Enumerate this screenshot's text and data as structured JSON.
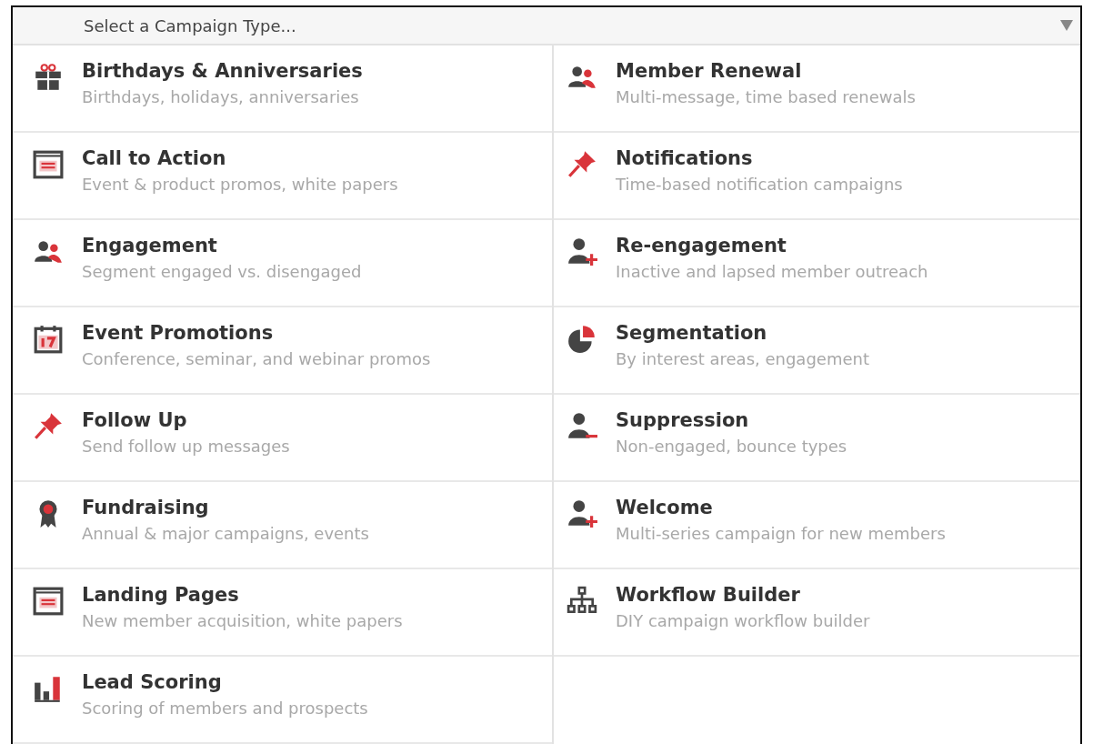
{
  "select": {
    "placeholder": "Select a Campaign Type..."
  },
  "columns": [
    {
      "items": [
        {
          "kind": "gift",
          "title": "Birthdays & Anniversaries",
          "description": "Birthdays, holidays, anniversaries"
        },
        {
          "kind": "page",
          "title": "Call to Action",
          "description": "Event & product promos, white papers"
        },
        {
          "kind": "people",
          "title": "Engagement",
          "description": "Segment engaged vs. disengaged"
        },
        {
          "kind": "calendar",
          "title": "Event Promotions",
          "description": "Conference, seminar, and webinar promos"
        },
        {
          "kind": "pin",
          "title": "Follow Up",
          "description": "Send follow up messages"
        },
        {
          "kind": "ribbon",
          "title": "Fundraising",
          "description": "Annual & major campaigns, events"
        },
        {
          "kind": "page",
          "title": "Landing Pages",
          "description": "New member acquisition, white papers"
        },
        {
          "kind": "bars",
          "title": "Lead Scoring",
          "description": "Scoring of members and prospects"
        }
      ]
    },
    {
      "items": [
        {
          "kind": "people",
          "title": "Member Renewal",
          "description": "Multi-message, time based renewals"
        },
        {
          "kind": "pin",
          "title": "Notifications",
          "description": "Time-based notification campaigns"
        },
        {
          "kind": "person-plus",
          "title": "Re-engagement",
          "description": "Inactive and lapsed member outreach"
        },
        {
          "kind": "pie",
          "title": "Segmentation",
          "description": "By interest areas, engagement"
        },
        {
          "kind": "person-minus",
          "title": "Suppression",
          "description": "Non-engaged, bounce types"
        },
        {
          "kind": "person-plus",
          "title": "Welcome",
          "description": "Multi-series campaign for new members"
        },
        {
          "kind": "sitemap",
          "title": "Workflow Builder",
          "description": "DIY campaign workflow builder"
        }
      ]
    }
  ]
}
